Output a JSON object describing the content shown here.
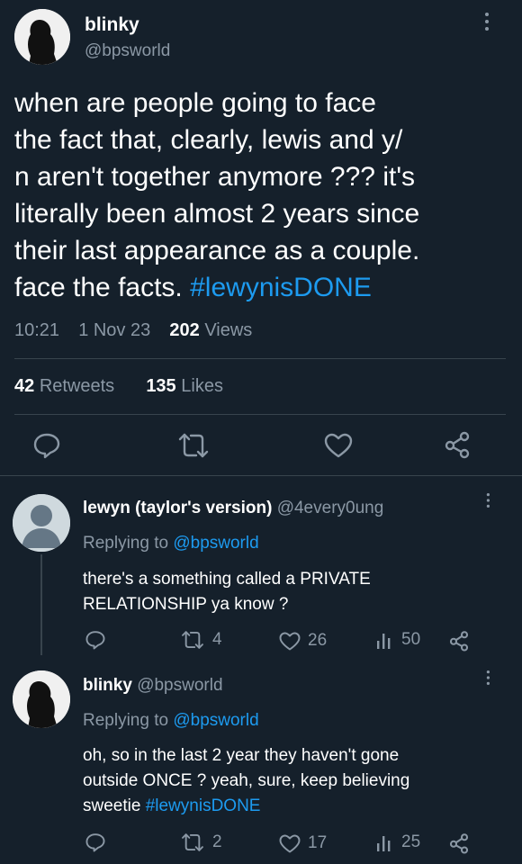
{
  "main_tweet": {
    "display_name": "blinky",
    "handle": "@bpsworld",
    "text_line1": "when are people going to face",
    "text_line2": "the fact that, clearly, lewis and y/",
    "text_line3": "n aren't together anymore ??? it's",
    "text_line4": "literally been almost 2 years since",
    "text_line5": "their last appearance as a couple.",
    "text_line6_prefix": "face the facts.",
    "hashtag": "#lewynisDONE",
    "time": "10:21",
    "date": "1 Nov 23",
    "views_count": "202",
    "views_label": "Views",
    "retweets_count": "42",
    "retweets_label": "Retweets",
    "likes_count": "135",
    "likes_label": "Likes"
  },
  "replies": [
    {
      "display_name": "lewyn (taylor's version)",
      "handle": "@4every0ung",
      "replying_label": "Replying to",
      "replying_to": "@bpsworld",
      "text_line1": "there's a something called a PRIVATE",
      "text_line2": "RELATIONSHIP ya know ?",
      "retweets": "4",
      "likes": "26",
      "views": "50"
    },
    {
      "display_name": "blinky",
      "handle": "@bpsworld",
      "replying_label": "Replying to",
      "replying_to": "@bpsworld",
      "text_line1": "oh, so in the last 2 year they haven't gone",
      "text_line2": "outside ONCE ? yeah, sure, keep believing",
      "text_line3_prefix": "sweetie",
      "hashtag": "#lewynisDONE",
      "retweets": "2",
      "likes": "17",
      "views": "25"
    }
  ],
  "colors": {
    "background": "#15202b",
    "text": "#ffffff",
    "muted": "#8b98a5",
    "link": "#1d9bf0",
    "divider": "#38444d"
  }
}
